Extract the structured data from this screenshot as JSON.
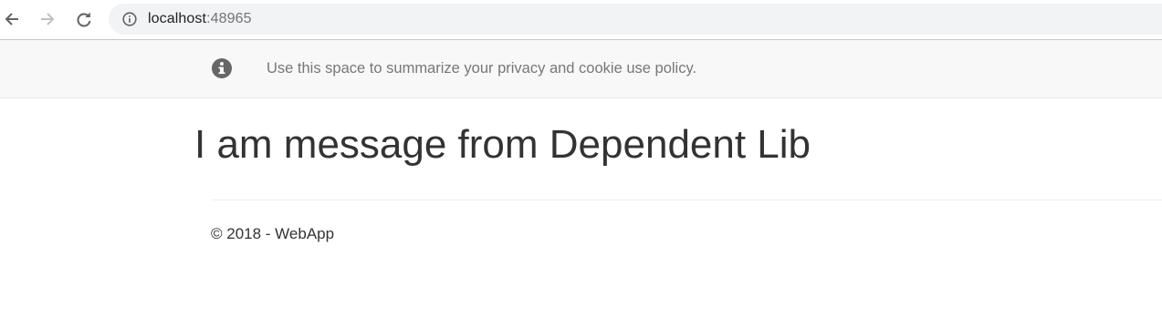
{
  "browser": {
    "url_host": "localhost",
    "url_port": ":48965"
  },
  "cookie_consent": {
    "message": "Use this space to summarize your privacy and cookie use policy."
  },
  "main": {
    "heading": "I am message from Dependent Lib"
  },
  "footer": {
    "copyright": "© 2018 - WebApp"
  },
  "colors": {
    "cookie_bar_bg": "#f8f8f8",
    "text_primary": "#333333",
    "text_muted": "#777777",
    "omnibox_bg": "#f1f3f4"
  }
}
